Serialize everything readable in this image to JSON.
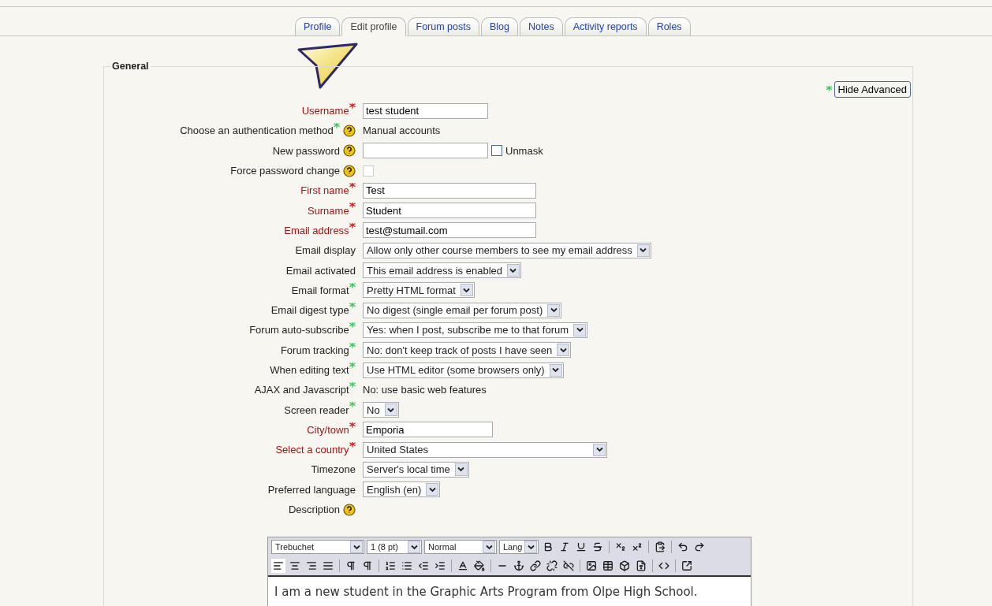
{
  "tabs": [
    {
      "label": "Profile",
      "selected": false
    },
    {
      "label": "Edit profile",
      "selected": true
    },
    {
      "label": "Forum posts",
      "selected": false
    },
    {
      "label": "Blog",
      "selected": false
    },
    {
      "label": "Notes",
      "selected": false
    },
    {
      "label": "Activity reports",
      "selected": false
    },
    {
      "label": "Roles",
      "selected": false
    }
  ],
  "fieldset": {
    "legend": "General",
    "toggle": {
      "marker": {
        "text": "*",
        "color": "#33cc55"
      },
      "label": "Hide Advanced"
    }
  },
  "fields": [
    {
      "label": "Username",
      "required": true,
      "marker": {
        "text": "*",
        "color": "#cc2222"
      },
      "help": false,
      "kind": "text",
      "value": "test student"
    },
    {
      "label": "Choose an authentication method",
      "required": false,
      "marker": {
        "text": "*",
        "color": "#33cc55"
      },
      "help": true,
      "kind": "static",
      "value": "Manual accounts"
    },
    {
      "label": "New password",
      "required": false,
      "help": true,
      "kind": "password",
      "unmask": {
        "label": "Unmask",
        "checked": false
      }
    },
    {
      "label": "Force password change",
      "required": false,
      "help": true,
      "kind": "checkbox",
      "checked": false,
      "disabled": true
    },
    {
      "label": "First name",
      "required": true,
      "marker": {
        "text": "*",
        "color": "#cc2222"
      },
      "help": false,
      "kind": "text",
      "value": "Test"
    },
    {
      "label": "Surname",
      "required": true,
      "marker": {
        "text": "*",
        "color": "#cc2222"
      },
      "help": false,
      "kind": "text",
      "value": "Student"
    },
    {
      "label": "Email address",
      "required": true,
      "marker": {
        "text": "*",
        "color": "#cc2222"
      },
      "help": false,
      "kind": "text",
      "value": "test@stumail.com"
    },
    {
      "label": "Email display",
      "required": false,
      "help": false,
      "kind": "select",
      "value": "Allow only other course members to see my email address"
    },
    {
      "label": "Email activated",
      "required": false,
      "help": false,
      "kind": "select",
      "value": "This email address is enabled"
    },
    {
      "label": "Email format",
      "required": false,
      "marker": {
        "text": "*",
        "color": "#33cc55"
      },
      "help": false,
      "kind": "select",
      "value": "Pretty HTML format"
    },
    {
      "label": "Email digest type",
      "required": false,
      "marker": {
        "text": "*",
        "color": "#33cc55"
      },
      "help": false,
      "kind": "select",
      "value": "No digest (single email per forum post)"
    },
    {
      "label": "Forum auto-subscribe",
      "required": false,
      "marker": {
        "text": "*",
        "color": "#33cc55"
      },
      "help": false,
      "kind": "select",
      "value": "Yes: when I post, subscribe me to that forum"
    },
    {
      "label": "Forum tracking",
      "required": false,
      "marker": {
        "text": "*",
        "color": "#33cc55"
      },
      "help": false,
      "kind": "select",
      "value": "No: don't keep track of posts I have seen"
    },
    {
      "label": "When editing text",
      "required": false,
      "marker": {
        "text": "*",
        "color": "#33cc55"
      },
      "help": false,
      "kind": "select",
      "value": "Use HTML editor (some browsers only)"
    },
    {
      "label": "AJAX and Javascript",
      "required": false,
      "marker": {
        "text": "*",
        "color": "#33cc55"
      },
      "help": false,
      "kind": "static",
      "value": "No: use basic web features"
    },
    {
      "label": "Screen reader",
      "required": false,
      "marker": {
        "text": "*",
        "color": "#33cc55"
      },
      "help": false,
      "kind": "select",
      "value": "No"
    },
    {
      "label": "City/town",
      "required": true,
      "marker": {
        "text": "*",
        "color": "#cc2222"
      },
      "help": false,
      "kind": "text",
      "value": "Emporia"
    },
    {
      "label": "Select a country",
      "required": true,
      "marker": {
        "text": "*",
        "color": "#cc2222"
      },
      "help": false,
      "kind": "select",
      "value": "United States"
    },
    {
      "label": "Timezone",
      "required": false,
      "help": false,
      "kind": "select",
      "value": "Server's local time"
    },
    {
      "label": "Preferred language",
      "required": false,
      "help": false,
      "kind": "select",
      "value": "English (en)"
    },
    {
      "label": "Description",
      "required": false,
      "help": true,
      "kind": "label"
    }
  ],
  "editor": {
    "font": "Trebuchet",
    "size": "1 (8 pt)",
    "format": "Normal",
    "lang": "Lang",
    "text": "I am a new student in the Graphic Arts Program from Olpe High School."
  }
}
